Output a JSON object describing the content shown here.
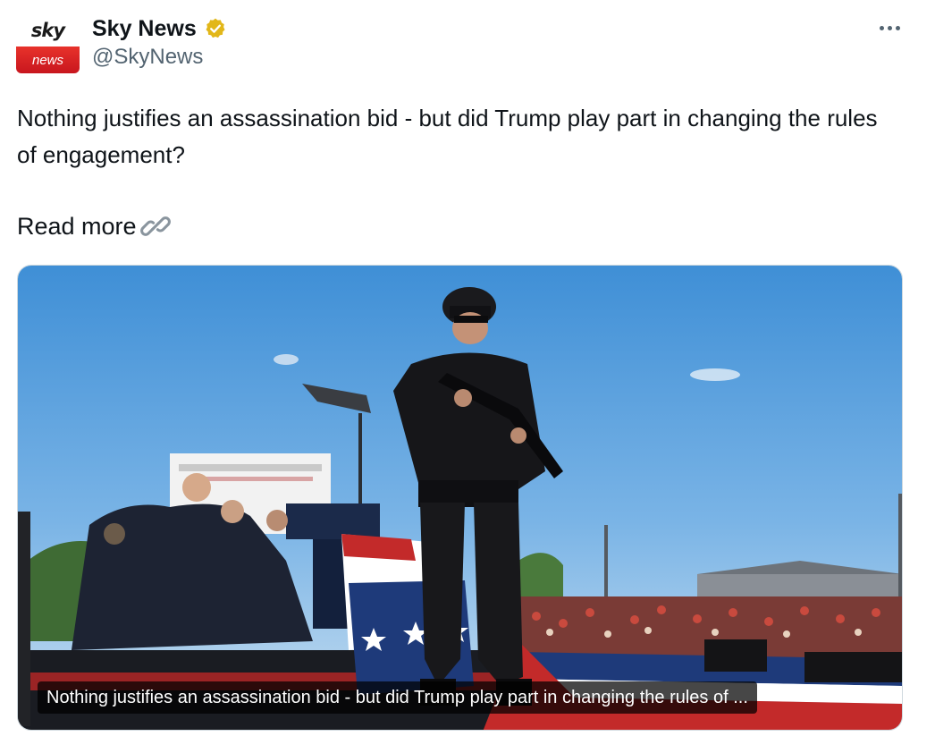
{
  "account": {
    "display_name": "Sky News",
    "handle": "@SkyNews",
    "avatar_top_text": "sky",
    "avatar_bottom_text": "news",
    "verified_color": "#e2b719",
    "avatar_accent": "#d42027"
  },
  "menu": {
    "icon": "more-horizontal-icon"
  },
  "post": {
    "text": "Nothing justifies an assassination bid - but did Trump play part in changing the rules of engagement?",
    "read_more_label": "Read more",
    "read_more_icon": "link-icon"
  },
  "media": {
    "caption": "Nothing justifies an assassination bid - but did Trump play part in changing the rules of ..."
  }
}
